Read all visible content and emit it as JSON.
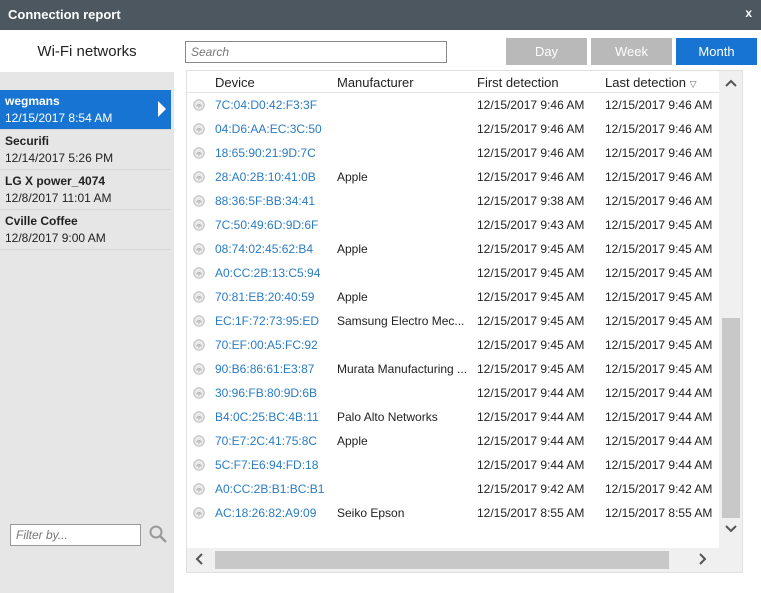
{
  "window": {
    "title": "Connection report",
    "close_label": "x"
  },
  "sidebar": {
    "header": "Wi-Fi networks",
    "networks": [
      {
        "name": "wegmans",
        "date": "12/15/2017 8:54 AM",
        "selected": true
      },
      {
        "name": "Securifi",
        "date": "12/14/2017 5:26 PM",
        "selected": false
      },
      {
        "name": "LG X power_4074",
        "date": "12/8/2017 11:01 AM",
        "selected": false
      },
      {
        "name": "Cville Coffee",
        "date": "12/8/2017 9:00 AM",
        "selected": false
      }
    ],
    "filter_placeholder": "Filter by..."
  },
  "toolbar": {
    "search_placeholder": "Search",
    "day_label": "Day",
    "week_label": "Week",
    "month_label": "Month"
  },
  "table": {
    "columns": {
      "device": "Device",
      "manufacturer": "Manufacturer",
      "first": "First detection",
      "last": "Last detection"
    },
    "rows": [
      {
        "device": "7C:04:D0:42:F3:3F",
        "manufacturer": "",
        "first": "12/15/2017 9:46 AM",
        "last": "12/15/2017 9:46 AM"
      },
      {
        "device": "04:D6:AA:EC:3C:50",
        "manufacturer": "",
        "first": "12/15/2017 9:46 AM",
        "last": "12/15/2017 9:46 AM"
      },
      {
        "device": "18:65:90:21:9D:7C",
        "manufacturer": "",
        "first": "12/15/2017 9:46 AM",
        "last": "12/15/2017 9:46 AM"
      },
      {
        "device": "28:A0:2B:10:41:0B",
        "manufacturer": "Apple",
        "first": "12/15/2017 9:46 AM",
        "last": "12/15/2017 9:46 AM"
      },
      {
        "device": "88:36:5F:BB:34:41",
        "manufacturer": "",
        "first": "12/15/2017 9:38 AM",
        "last": "12/15/2017 9:46 AM"
      },
      {
        "device": "7C:50:49:6D:9D:6F",
        "manufacturer": "",
        "first": "12/15/2017 9:43 AM",
        "last": "12/15/2017 9:45 AM"
      },
      {
        "device": "08:74:02:45:62:B4",
        "manufacturer": "Apple",
        "first": "12/15/2017 9:45 AM",
        "last": "12/15/2017 9:45 AM"
      },
      {
        "device": "A0:CC:2B:13:C5:94",
        "manufacturer": "",
        "first": "12/15/2017 9:45 AM",
        "last": "12/15/2017 9:45 AM"
      },
      {
        "device": "70:81:EB:20:40:59",
        "manufacturer": "Apple",
        "first": "12/15/2017 9:45 AM",
        "last": "12/15/2017 9:45 AM"
      },
      {
        "device": "EC:1F:72:73:95:ED",
        "manufacturer": "Samsung Electro Mec...",
        "first": "12/15/2017 9:45 AM",
        "last": "12/15/2017 9:45 AM"
      },
      {
        "device": "70:EF:00:A5:FC:92",
        "manufacturer": "",
        "first": "12/15/2017 9:45 AM",
        "last": "12/15/2017 9:45 AM"
      },
      {
        "device": "90:B6:86:61:E3:87",
        "manufacturer": "Murata Manufacturing ...",
        "first": "12/15/2017 9:45 AM",
        "last": "12/15/2017 9:45 AM"
      },
      {
        "device": "30:96:FB:80:9D:6B",
        "manufacturer": "",
        "first": "12/15/2017 9:44 AM",
        "last": "12/15/2017 9:44 AM"
      },
      {
        "device": "B4:0C:25:BC:4B:11",
        "manufacturer": "Palo Alto Networks",
        "first": "12/15/2017 9:44 AM",
        "last": "12/15/2017 9:44 AM"
      },
      {
        "device": "70:E7:2C:41:75:8C",
        "manufacturer": "Apple",
        "first": "12/15/2017 9:44 AM",
        "last": "12/15/2017 9:44 AM"
      },
      {
        "device": "5C:F7:E6:94:FD:18",
        "manufacturer": "",
        "first": "12/15/2017 9:44 AM",
        "last": "12/15/2017 9:44 AM"
      },
      {
        "device": "A0:CC:2B:B1:BC:B1",
        "manufacturer": "",
        "first": "12/15/2017 9:42 AM",
        "last": "12/15/2017 9:42 AM"
      },
      {
        "device": "AC:18:26:82:A9:09",
        "manufacturer": "Seiko Epson",
        "first": "12/15/2017 8:55 AM",
        "last": "12/15/2017 8:55 AM"
      }
    ]
  },
  "colors": {
    "accent": "#1874d2",
    "titlebar": "#4c5760",
    "link": "#2a7bc4"
  }
}
